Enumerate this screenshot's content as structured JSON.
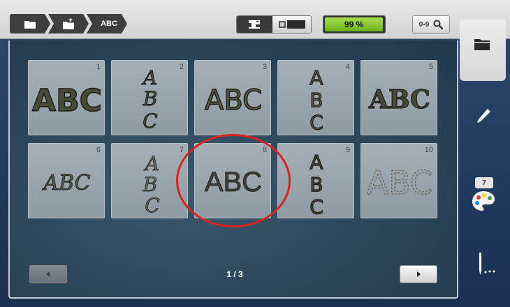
{
  "breadcrumb": {
    "items": [
      {
        "icon": "folder-icon"
      },
      {
        "icon": "folder-upload-icon"
      },
      {
        "label": "ABC"
      }
    ]
  },
  "mode_toggle": {
    "left_icon": "sewing-machine-icon",
    "right_icon": "embroidery-frame-icon"
  },
  "progress": {
    "label": "99 %",
    "value": 0.99,
    "color": "#8ccc30"
  },
  "search": {
    "label": "0-9",
    "icon": "magnifier-icon"
  },
  "sidebar": {
    "items": [
      {
        "icon": "folder-icon",
        "active": true
      },
      {
        "icon": "pencil-icon"
      },
      {
        "icon": "palette-icon",
        "badge": "7"
      },
      {
        "icon": "needle-icon"
      }
    ]
  },
  "fonts": [
    {
      "number": "1",
      "sample": "ABC",
      "style": "bold-rounded"
    },
    {
      "number": "2",
      "sample": "ABC",
      "style": "vertical-script"
    },
    {
      "number": "3",
      "sample": "ABC",
      "style": "outline-sans"
    },
    {
      "number": "4",
      "sample": "ABC",
      "style": "vertical-sans"
    },
    {
      "number": "5",
      "sample": "ABC",
      "style": "bold-serif"
    },
    {
      "number": "6",
      "sample": "ABC",
      "style": "italic-script"
    },
    {
      "number": "7",
      "sample": "ABC",
      "style": "vertical-calligraphy"
    },
    {
      "number": "8",
      "sample": "ABC",
      "style": "plain-sans",
      "selected": true
    },
    {
      "number": "9",
      "sample": "ABC",
      "style": "vertical-block"
    },
    {
      "number": "10",
      "sample": "ABC",
      "style": "dotted-outline"
    }
  ],
  "pagination": {
    "label": "1 / 3"
  },
  "highlight_color": "#d9241c"
}
